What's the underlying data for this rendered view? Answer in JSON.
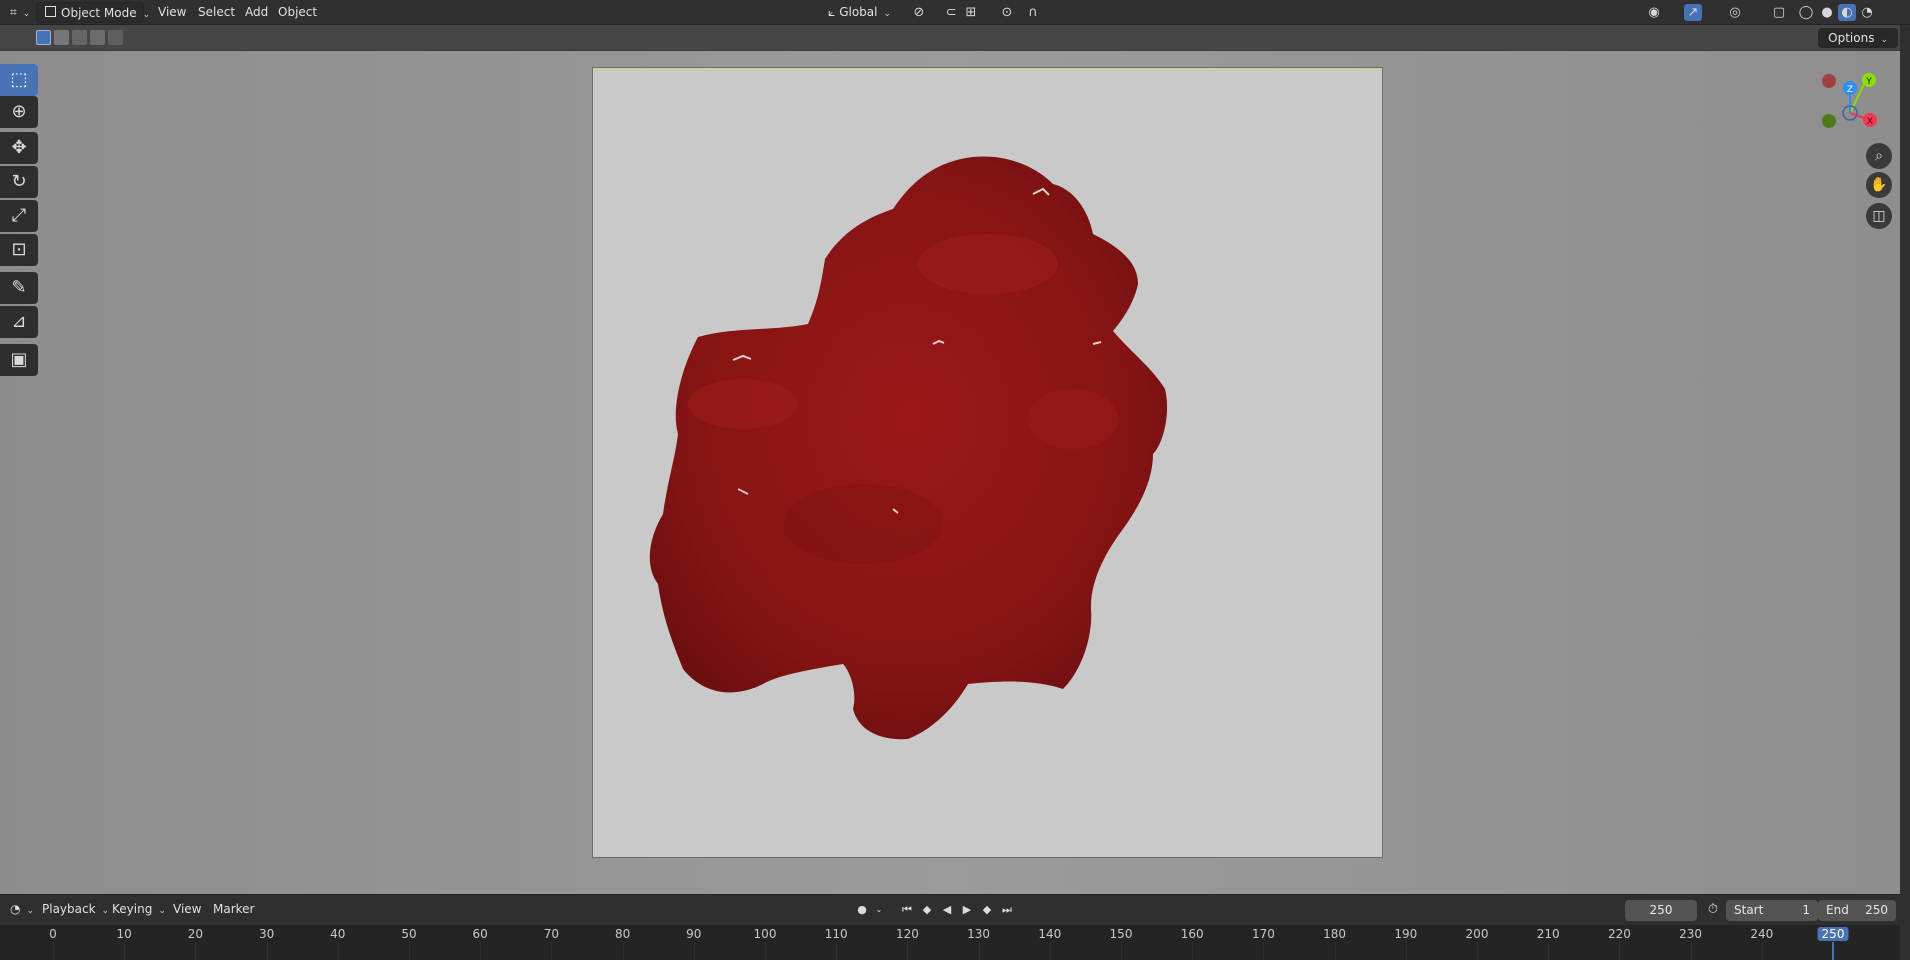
{
  "header": {
    "editor_type_icon": "editor-type-icon",
    "mode": "Object Mode",
    "menus": [
      "View",
      "Select",
      "Add",
      "Object"
    ],
    "orientation": "Global"
  },
  "tool_settings": {
    "options_label": "Options"
  },
  "gizmo": {
    "x_label": "X",
    "y_label": "Y",
    "z_label": "Z",
    "x_color": "#ff3352",
    "y_color": "#8bdc00",
    "z_color": "#2890ff"
  },
  "timeline": {
    "menus": [
      "Playback",
      "Keying",
      "View",
      "Marker"
    ],
    "current_frame": "250",
    "start_label": "Start",
    "start_value": "1",
    "end_label": "End",
    "end_value": "250",
    "ticks": [
      "0",
      "10",
      "20",
      "30",
      "40",
      "50",
      "60",
      "70",
      "80",
      "90",
      "100",
      "110",
      "120",
      "130",
      "140",
      "150",
      "160",
      "170",
      "180",
      "190",
      "200",
      "210",
      "220",
      "230",
      "240",
      "250"
    ],
    "playhead": "250"
  },
  "colors": {
    "accent": "#4772b3",
    "blob": "#8c1717",
    "camera_bg": "#c9c9c9"
  }
}
